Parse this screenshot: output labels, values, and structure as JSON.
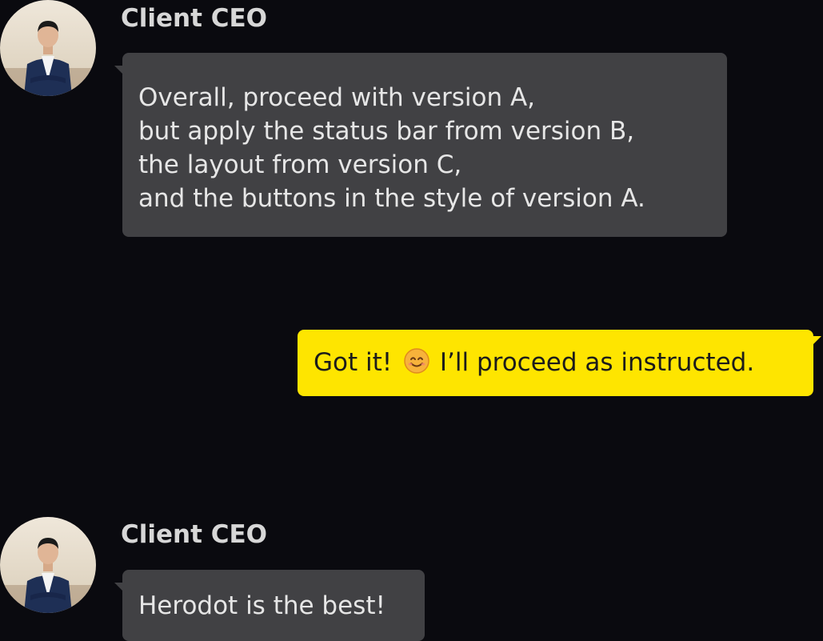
{
  "messages": [
    {
      "sender": "Client CEO",
      "direction": "incoming",
      "lines": [
        "Overall, proceed with version A,",
        "but apply the status bar from version B,",
        "the layout from version C,",
        "and the buttons in the style of version A."
      ]
    },
    {
      "direction": "outgoing",
      "text_before": "Got it!",
      "emoji": "smiling-face-icon",
      "text_after": "I’ll proceed as instructed."
    },
    {
      "sender": "Client CEO",
      "direction": "incoming",
      "lines": [
        "Herodot is the best!"
      ]
    }
  ],
  "colors": {
    "background": "#0a0a0f",
    "incoming_bubble": "#414144",
    "outgoing_bubble": "#fee500",
    "sender_name": "#d7d7d7"
  }
}
